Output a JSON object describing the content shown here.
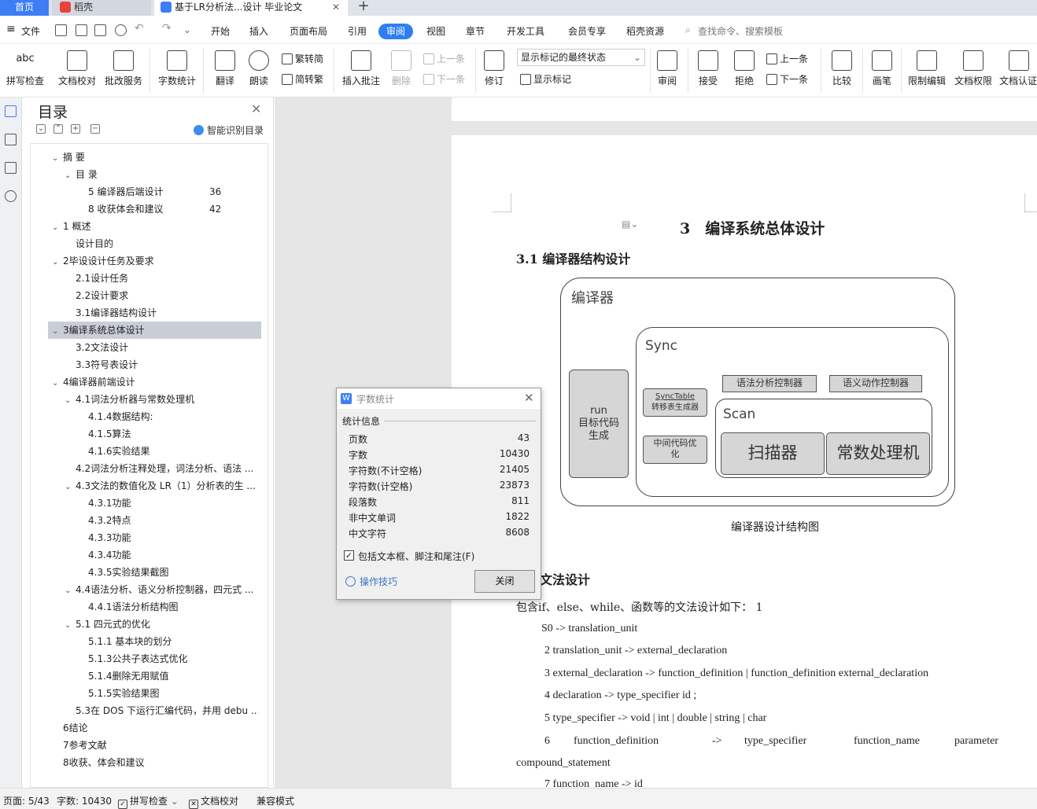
{
  "tabs": {
    "home": "首页",
    "daoke": "稻壳",
    "doc": "基于LR分析法...设计 毕业论文",
    "plus": "+"
  },
  "menubar": {
    "file": "文件",
    "items": [
      "开始",
      "插入",
      "页面布局",
      "引用",
      "审阅",
      "视图",
      "章节",
      "开发工具",
      "会员专享",
      "稻壳资源"
    ],
    "search_placeholder": "查找命令、搜索模板"
  },
  "ribbon": {
    "spell_check": "拼写检查",
    "doc_proof": "文档校对",
    "batch_service": "批改服务",
    "word_count": "字数统计",
    "translate": "翻译",
    "read_aloud": "朗读",
    "to_traditional": "繁转简",
    "to_simplified": "简转繁",
    "insert_comment": "插入批注",
    "delete": "删除",
    "prev_comment": "上一条",
    "next_comment": "下一条",
    "revise": "修订",
    "show_mode": "显示标记的最终状态",
    "show_marks": "显示标记",
    "review": "审阅",
    "accept": "接受",
    "reject": "拒绝",
    "prev_change": "上一条",
    "next_change": "下一条",
    "compare": "比较",
    "pen": "画笔",
    "restrict_edit": "限制编辑",
    "doc_permission": "文档权限",
    "doc_auth": "文档认证"
  },
  "toc": {
    "title": "目录",
    "smart": "智能识别目录",
    "items": [
      {
        "text": "摘 要",
        "chev": "v",
        "level": 1
      },
      {
        "text": "目 录",
        "chev": "v",
        "level": 2
      },
      {
        "text": "5 编译器后端设计",
        "level": 3,
        "page": "36"
      },
      {
        "text": "8 收获体会和建议",
        "level": 3,
        "page": "42"
      },
      {
        "text": "1 概述",
        "chev": "v",
        "level": 1
      },
      {
        "text": "设计目的",
        "level": 2
      },
      {
        "text": "2毕设设计任务及要求",
        "chev": "v",
        "level": 1
      },
      {
        "text": "2.1设计任务",
        "level": 2
      },
      {
        "text": "2.2设计要求",
        "level": 2
      },
      {
        "text": "3.1编译器结构设计",
        "level": 2
      },
      {
        "text": "3编译系统总体设计",
        "chev": "v",
        "level": 1
      },
      {
        "text": "3.2文法设计",
        "level": 2
      },
      {
        "text": "3.3符号表设计",
        "level": 2
      },
      {
        "text": "4编译器前端设计",
        "chev": "v",
        "level": 1
      },
      {
        "text": "4.1词法分析器与常数处理机",
        "chev": "v",
        "level": 2
      },
      {
        "text": "4.1.4数据结构:",
        "level": 3
      },
      {
        "text": "4.1.5算法",
        "level": 3
      },
      {
        "text": "4.1.6实验结果",
        "level": 3
      },
      {
        "text": "4.2词法分析注释处理，词法分析、语法 ...",
        "level": 2
      },
      {
        "text": "4.3文法的数值化及 LR（1）分析表的生 ...",
        "chev": "v",
        "level": 2
      },
      {
        "text": "4.3.1功能",
        "level": 3
      },
      {
        "text": "4.3.2特点",
        "level": 3
      },
      {
        "text": "4.3.3功能",
        "level": 3
      },
      {
        "text": "4.3.4功能",
        "level": 3
      },
      {
        "text": "4.3.5实验结果截图",
        "level": 3
      },
      {
        "text": "4.4语法分析、语义分析控制器，四元式 ...",
        "chev": "v",
        "level": 2
      },
      {
        "text": "4.4.1语法分析结构图",
        "level": 3
      },
      {
        "text": "5.1 四元式的优化",
        "chev": "v",
        "level": 2
      },
      {
        "text": "5.1.1 基本块的划分",
        "level": 3
      },
      {
        "text": "5.1.3公共子表达式优化",
        "level": 3
      },
      {
        "text": "5.1.4删除无用赋值",
        "level": 3
      },
      {
        "text": "5.1.5实验结果图",
        "level": 3
      },
      {
        "text": "5.3在 DOS 下运行汇编代码，并用 debu ...",
        "level": 2
      },
      {
        "text": "6结论",
        "level": 1
      },
      {
        "text": "7参考文献",
        "level": 1
      },
      {
        "text": "8收获、体会和建议",
        "level": 1
      }
    ]
  },
  "document": {
    "chapter_title": "3　编译系统总体设计",
    "sec31": "3.1 编译器结构设计",
    "diagram": {
      "outer": "编译器",
      "sync": "Sync",
      "run_lines": [
        "run",
        "目标代码",
        "生成"
      ],
      "synctable_lines": [
        "SyncTable",
        "转移表生成器"
      ],
      "mid_opt_lines": [
        "中间代码优",
        "化"
      ],
      "syntax_ctrl": "语法分析控制器",
      "semantic_ctrl": "语义动作控制器",
      "scan": "Scan",
      "scanner": "扫描器",
      "const_proc": "常数处理机"
    },
    "caption": "编译器设计结构图",
    "sec32": "文法设计",
    "intro": "包含if、else、while、函数等的文法设计如下： 1",
    "g0": "S0 -> translation_unit",
    "g2": "2 translation_unit -> external_declaration",
    "g3": "3 external_declaration -> function_definition | function_definition external_declaration",
    "g4": "4 declaration -> type_specifier id ;",
    "g5": "5 type_specifier -> void | int | double | string | char",
    "g6": [
      "6",
      "function_definition",
      "->",
      "type_specifier",
      "function_name",
      "parameter"
    ],
    "g6b": "compound_statement",
    "g7": "7 function_name -> id"
  },
  "dialog": {
    "title": "字数统计",
    "section": "统计信息",
    "rows": [
      {
        "label": "页数",
        "value": "43"
      },
      {
        "label": "字数",
        "value": "10430"
      },
      {
        "label": "字符数(不计空格)",
        "value": "21405"
      },
      {
        "label": "字符数(计空格)",
        "value": "23873"
      },
      {
        "label": "段落数",
        "value": "811"
      },
      {
        "label": "非中文单词",
        "value": "1822"
      },
      {
        "label": "中文字符",
        "value": "8608"
      }
    ],
    "checkbox_label": "包括文本框、脚注和尾注(F)",
    "checkbox_checked": true,
    "tips": "操作技巧",
    "close": "关闭"
  },
  "status": {
    "page": "页面: 5/43",
    "words": "字数: 10430",
    "spell": "拼写检查",
    "proof": "文档校对",
    "compat": "兼容模式"
  },
  "colors": {
    "accent": "#2f7ff0",
    "tab_active": "#3d7ef5",
    "toc_selected": "#c8cdd6",
    "workspace": "#e6e6e6"
  }
}
